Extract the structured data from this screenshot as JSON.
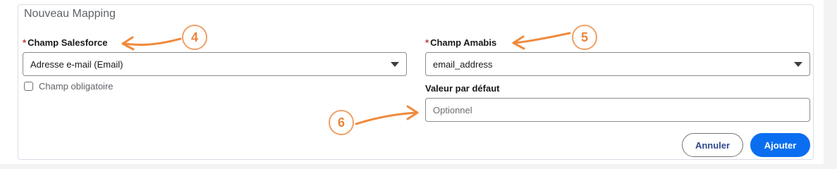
{
  "panel": {
    "title": "Nouveau Mapping"
  },
  "salesforce_field": {
    "required_mark": "*",
    "label": "Champ Salesforce",
    "selected_value": "Adresse e-mail (Email)"
  },
  "required_checkbox": {
    "label": "Champ obligatoire",
    "checked": false
  },
  "amabis_field": {
    "required_mark": "*",
    "label": "Champ Amabis",
    "selected_value": "email_address"
  },
  "default_value": {
    "label": "Valeur par défaut",
    "placeholder": "Optionnel",
    "value": ""
  },
  "buttons": {
    "cancel": "Annuler",
    "add": "Ajouter"
  },
  "annotations": {
    "callout_4": "4",
    "callout_5": "5",
    "callout_6": "6",
    "color": "#f08a3c"
  },
  "colors": {
    "accent": "#0b6ef0",
    "required": "#c23934"
  }
}
